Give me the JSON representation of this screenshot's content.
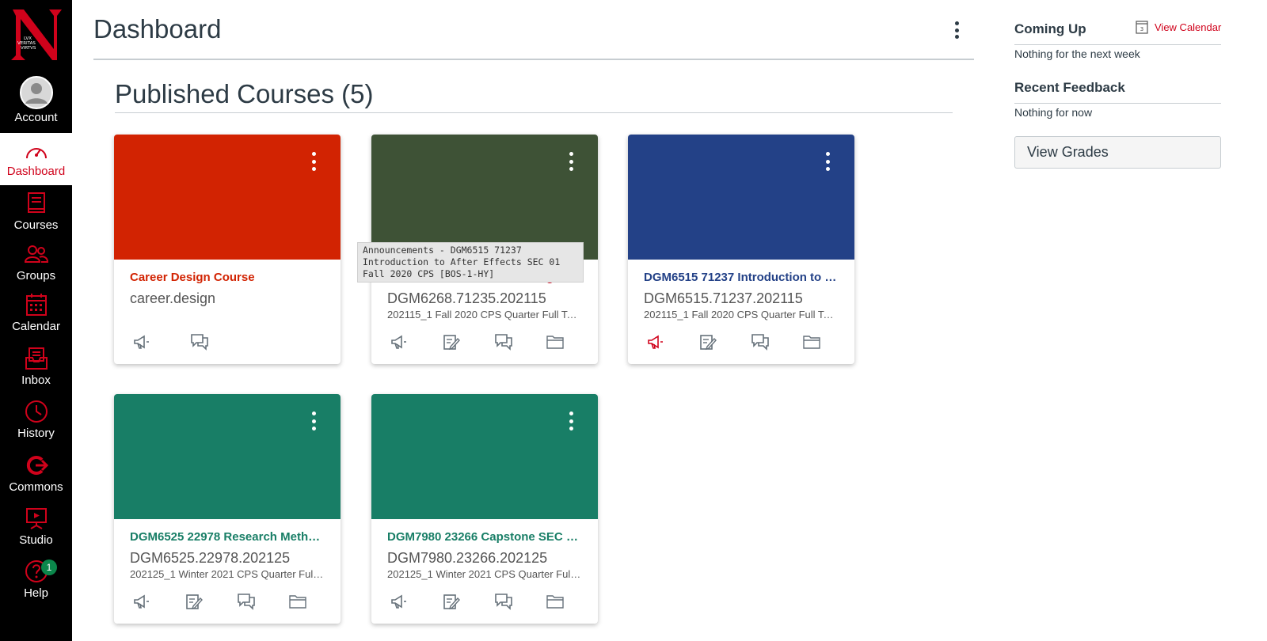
{
  "nav": {
    "logo_letter": "N",
    "logo_text": [
      "LVX",
      "VERITAS",
      "VIRTVS"
    ],
    "items": [
      {
        "label": "Account",
        "icon": "account-avatar-icon"
      },
      {
        "label": "Dashboard",
        "icon": "dashboard-icon",
        "active": true
      },
      {
        "label": "Courses",
        "icon": "courses-icon"
      },
      {
        "label": "Groups",
        "icon": "groups-icon"
      },
      {
        "label": "Calendar",
        "icon": "calendar-icon"
      },
      {
        "label": "Inbox",
        "icon": "inbox-icon"
      },
      {
        "label": "History",
        "icon": "history-icon"
      },
      {
        "label": "Commons",
        "icon": "commons-icon"
      },
      {
        "label": "Studio",
        "icon": "studio-icon"
      },
      {
        "label": "Help",
        "icon": "help-icon",
        "badge": "1"
      }
    ]
  },
  "header": {
    "title": "Dashboard"
  },
  "main": {
    "section_title": "Published Courses (5)",
    "cards": [
      {
        "color": "#d22302",
        "title_color": "#d22302",
        "title": "Career Design Course",
        "code": "career.design",
        "term": "",
        "actions": [
          "announcements-icon",
          "discussions-icon"
        ]
      },
      {
        "color": "#3e5236",
        "title_color": "#d0021b",
        "title": "DGM6268 71235 Studio Design …",
        "code": "DGM6268.71235.202115",
        "term": "202115_1 Fall 2020 CPS Quarter Full Term",
        "actions": [
          "announcements-icon",
          "assignments-icon",
          "discussions-icon",
          "files-icon"
        ]
      },
      {
        "color": "#234187",
        "title_color": "#234187",
        "title": "DGM6515 71237 Introduction to …",
        "code": "DGM6515.71237.202115",
        "term": "202115_1 Fall 2020 CPS Quarter Full Term",
        "actions": [
          "announcements-icon",
          "assignments-icon",
          "discussions-icon",
          "files-icon"
        ],
        "announcement_active": true
      },
      {
        "color": "#187e66",
        "title_color": "#187e66",
        "title": "DGM6525 22978 Research Meth…",
        "code": "DGM6525.22978.202125",
        "term": "202125_1 Winter 2021 CPS Quarter Full…",
        "actions": [
          "announcements-icon",
          "assignments-icon",
          "discussions-icon",
          "files-icon"
        ]
      },
      {
        "color": "#187e66",
        "title_color": "#187e66",
        "title": "DGM7980 23266 Capstone SEC 0…",
        "code": "DGM7980.23266.202125",
        "term": "202125_1 Winter 2021 CPS Quarter Full…",
        "actions": [
          "announcements-icon",
          "assignments-icon",
          "discussions-icon",
          "files-icon"
        ]
      }
    ],
    "tooltip": "Announcements - DGM6515 71237 Introduction to After Effects SEC 01 Fall 2020 CPS [BOS-1-HY]"
  },
  "sidebar": {
    "coming_up": "Coming Up",
    "view_calendar": "View Calendar",
    "calendar_day": "3",
    "coming_up_empty": "Nothing for the next week",
    "recent_feedback": "Recent Feedback",
    "feedback_empty": "Nothing for now",
    "view_grades": "View Grades"
  },
  "colors": {
    "nav_bg": "#000000",
    "accent": "#d0021b",
    "text": "#2d3b45"
  }
}
